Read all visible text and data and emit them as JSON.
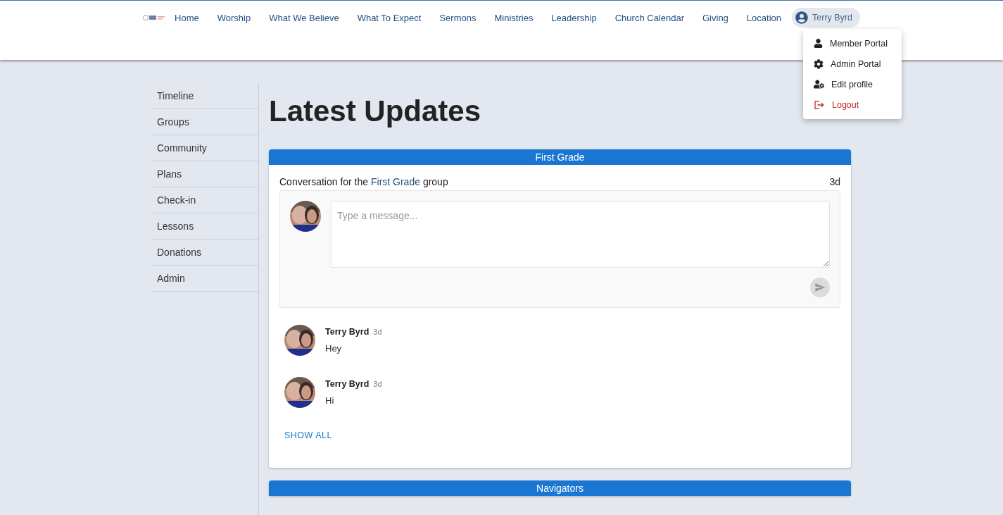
{
  "nav": {
    "links": [
      "Home",
      "Worship",
      "What We Believe",
      "What To Expect",
      "Sermons",
      "Ministries",
      "Leadership",
      "Church Calendar",
      "Giving",
      "Location"
    ],
    "user": "Terry Byrd"
  },
  "user_menu": {
    "items": [
      {
        "kind": "member",
        "label": "Member Portal"
      },
      {
        "kind": "admin",
        "label": "Admin Portal"
      },
      {
        "kind": "profile",
        "label": "Edit profile"
      },
      {
        "kind": "logout",
        "label": "Logout"
      }
    ]
  },
  "sidebar": {
    "items": [
      "Timeline",
      "Groups",
      "Community",
      "Plans",
      "Check-in",
      "Lessons",
      "Donations",
      "Admin"
    ]
  },
  "title": "Latest Updates",
  "cards": [
    {
      "header": "First Grade",
      "intro_before": "Conversation for the",
      "group_link": "First Grade",
      "intro_after": "group",
      "age": "3d",
      "composer": {
        "placeholder": "Type a message..."
      },
      "messages": [
        {
          "author": "Terry Byrd",
          "age": "3d",
          "text": "Hey"
        },
        {
          "author": "Terry Byrd",
          "age": "3d",
          "text": "Hi"
        }
      ],
      "show_all": "SHOW ALL"
    },
    {
      "header": "Navigators"
    }
  ]
}
